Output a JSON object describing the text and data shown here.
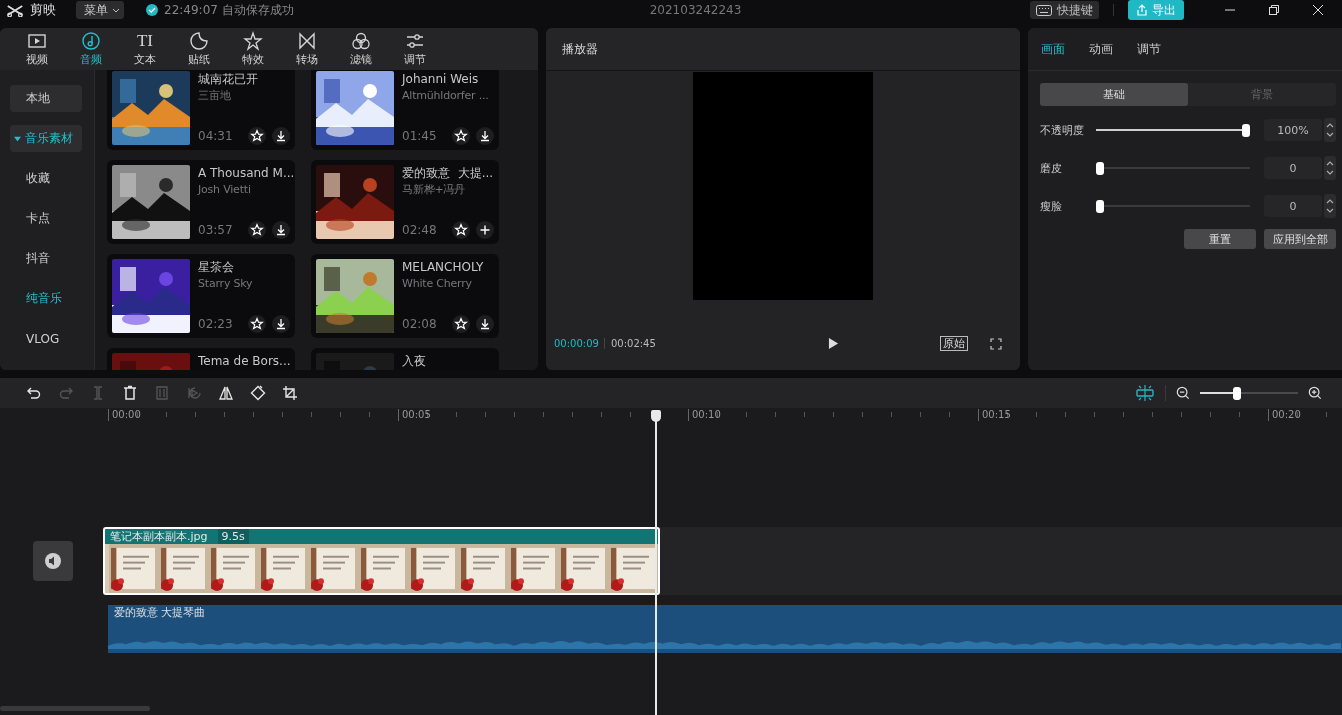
{
  "app": {
    "name": "剪映",
    "menu": "菜单",
    "autosave": "22:49:07 自动保存成功",
    "project": "202103242243",
    "shortcuts": "快捷键",
    "export": "导出"
  },
  "media_tabs": [
    {
      "label": "视频",
      "selected": false
    },
    {
      "label": "音频",
      "selected": true
    },
    {
      "label": "文本",
      "glyph": "TI",
      "selected": false
    },
    {
      "label": "贴纸",
      "selected": false
    },
    {
      "label": "特效",
      "selected": false
    },
    {
      "label": "转场",
      "selected": false
    },
    {
      "label": "滤镜",
      "selected": false
    },
    {
      "label": "调节",
      "selected": false
    }
  ],
  "sidebar": [
    {
      "label": "本地",
      "kind": "button",
      "selected": false
    },
    {
      "label": "音乐素材",
      "kind": "group",
      "expanded": true,
      "selected": false
    },
    {
      "label": "收藏",
      "kind": "item",
      "selected": false
    },
    {
      "label": "卡点",
      "kind": "item",
      "selected": false
    },
    {
      "label": "抖音",
      "kind": "item",
      "selected": false
    },
    {
      "label": "纯音乐",
      "kind": "item",
      "selected": true
    },
    {
      "label": "VLOG",
      "kind": "item",
      "selected": false
    }
  ],
  "music": [
    {
      "title": "城南花已开",
      "artist": "三亩地",
      "duration": "04:31",
      "kind": "download"
    },
    {
      "title": "Johanni Weis",
      "artist": "Altmühldorfer ...",
      "duration": "01:45",
      "kind": "download"
    },
    {
      "title": "A Thousand M...",
      "artist": "Josh Vietti",
      "duration": "03:57",
      "kind": "download"
    },
    {
      "title": "爱的致意  大提...",
      "artist": "马新桦+冯丹",
      "duration": "02:48",
      "kind": "add"
    },
    {
      "title": "星茶会",
      "artist": "Starry Sky",
      "duration": "02:23",
      "kind": "download"
    },
    {
      "title": "MELANCHOLY",
      "artist": "White Cherry",
      "duration": "02:08",
      "kind": "download"
    },
    {
      "title": "Tema de Bors..."
    },
    {
      "title": "入夜"
    }
  ],
  "player": {
    "title": "播放器",
    "current": "00:00:09",
    "total": "00:02:45",
    "ratio": "原始"
  },
  "inspector": {
    "tabs": [
      {
        "label": "画面",
        "selected": true
      },
      {
        "label": "动画",
        "selected": false
      },
      {
        "label": "调节",
        "selected": false
      }
    ],
    "segments": [
      {
        "label": "基础",
        "selected": true
      },
      {
        "label": "背景",
        "selected": false
      }
    ],
    "sliders": [
      {
        "label": "不透明度",
        "level": 1,
        "value": "100%"
      },
      {
        "label": "磨皮",
        "level": 0,
        "value": "0"
      },
      {
        "label": "瘦脸",
        "level": 0,
        "value": "0"
      }
    ],
    "buttons": [
      "重置",
      "应用到全部"
    ]
  },
  "timeline": {
    "tools": [
      {
        "disabled": false
      },
      {
        "disabled": true
      },
      {
        "disabled": true
      },
      {
        "disabled": false
      },
      {
        "disabled": true
      },
      {
        "disabled": true
      },
      {
        "disabled": false
      },
      {
        "disabled": false
      },
      {
        "disabled": false
      }
    ],
    "snap": {
      "on": true
    },
    "zoom": {
      "level": 0.37
    },
    "ruler": [
      "00:00",
      "00:05",
      "00:10",
      "00:15",
      "00:20"
    ],
    "video_clip": {
      "name": "笔记本副本副本.jpg",
      "duration": "9.5s",
      "selected": true
    },
    "audio_clip": {
      "name": "爱的致意 大提琴曲"
    }
  }
}
